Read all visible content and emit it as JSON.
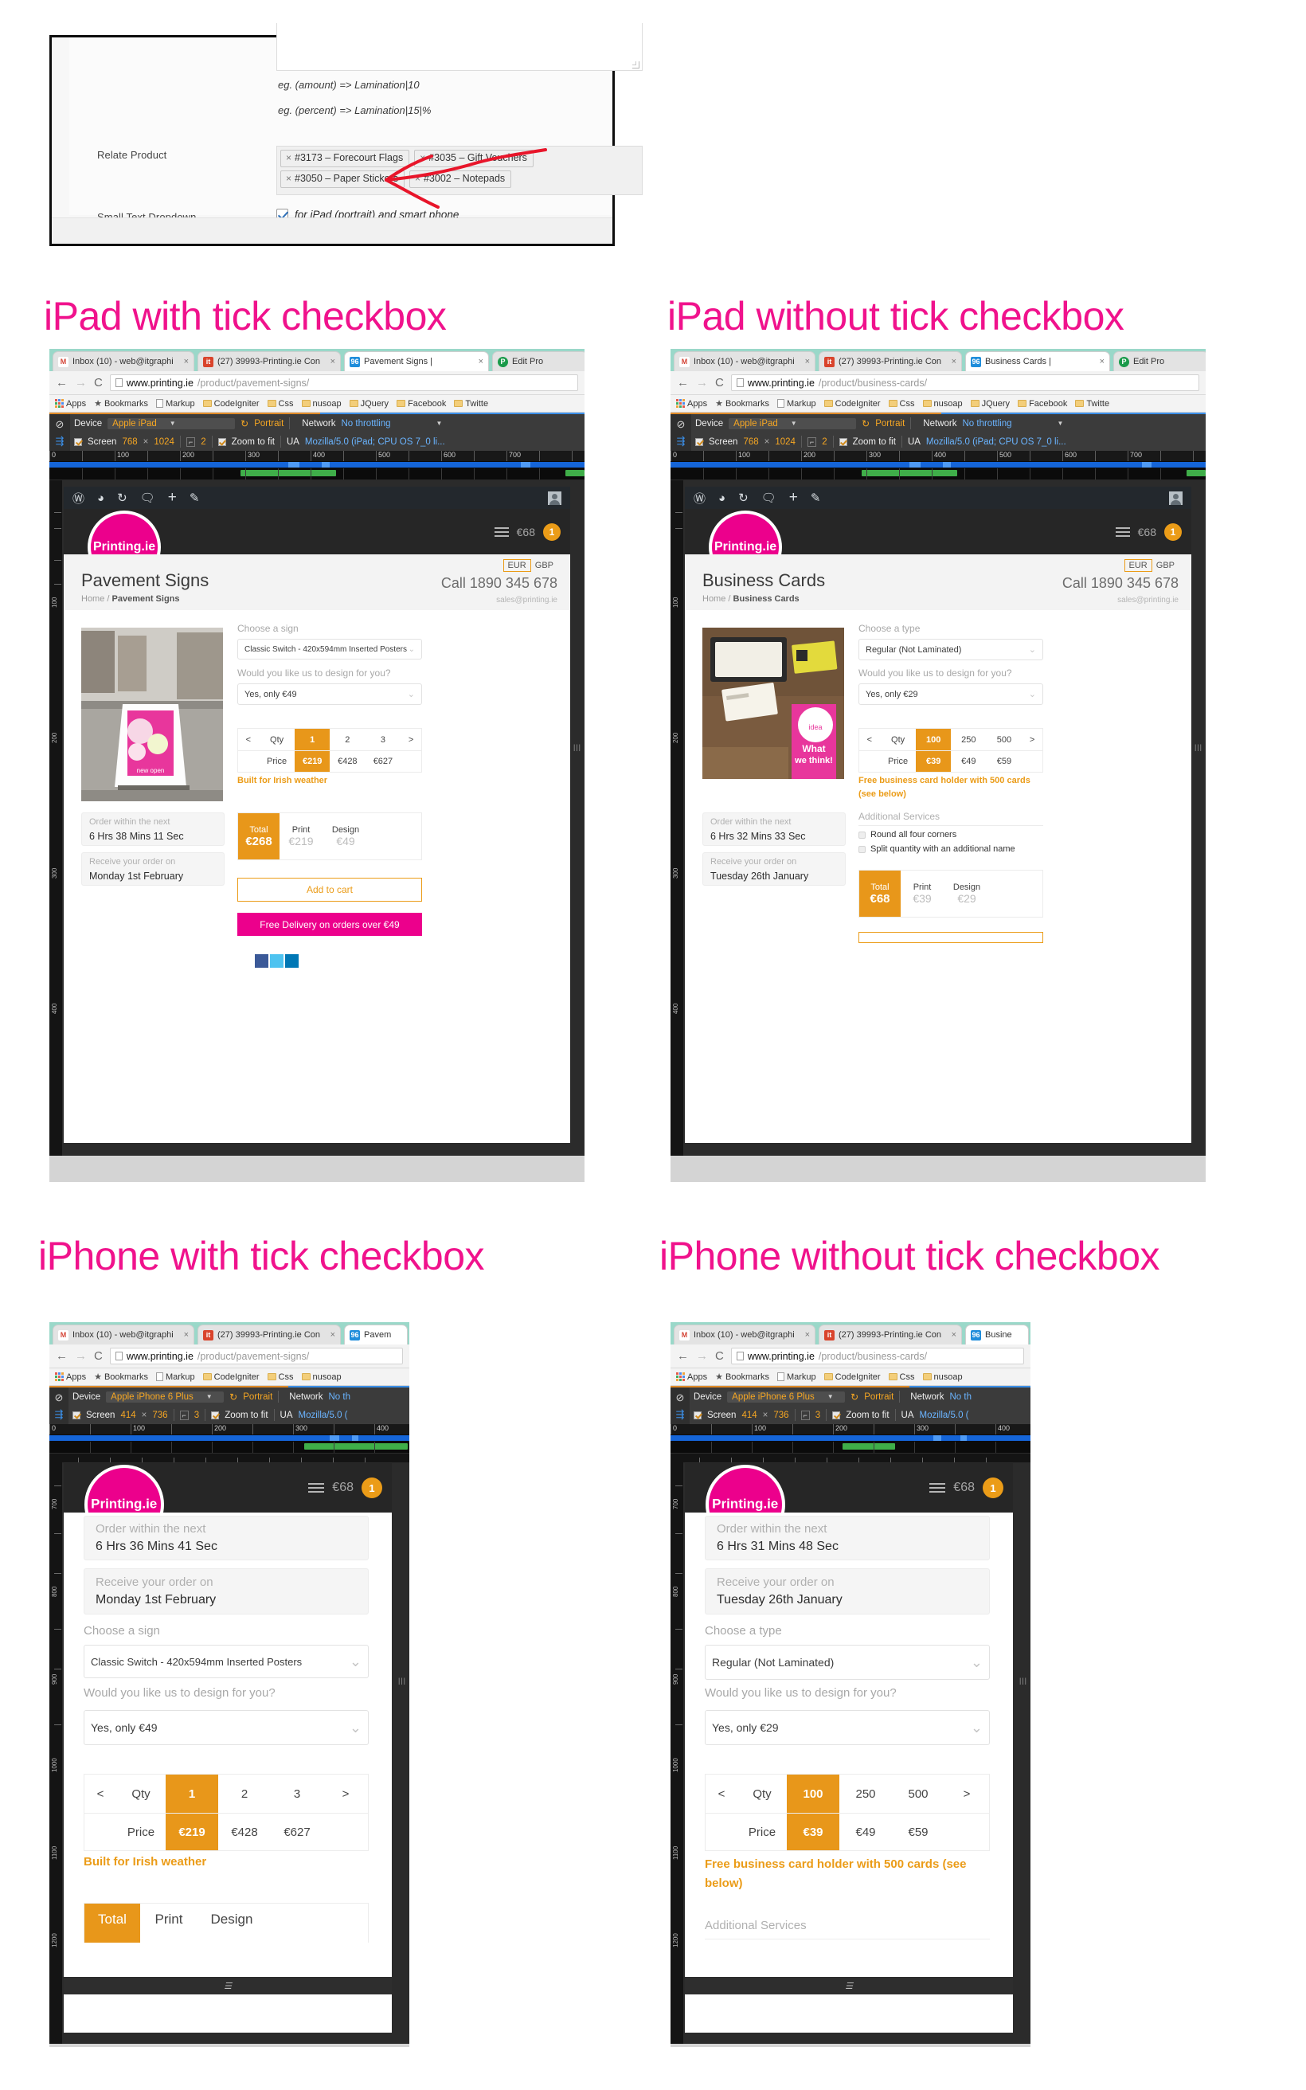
{
  "admin": {
    "hint1": "eg. (amount) => Lamination|10",
    "hint2": "eg. (percent) => Lamination|15|%",
    "relate_label": "Relate Product",
    "tags": [
      "#3173 – Forecourt Flags",
      "#3035 – Gift Vouchers",
      "#3050 – Paper Stickers",
      "#3002 – Notepads"
    ],
    "tag_remove": "×",
    "checkbox_label": "Small Text Dropdown",
    "checkbox_text": "for iPad (portrait) and smart phone",
    "checkbox_checked": true
  },
  "sections": {
    "ipad_with": "iPad with tick checkbox",
    "ipad_without": "iPad without tick checkbox",
    "iphone_with": "iPhone with tick checkbox",
    "iphone_without": "iPhone without tick checkbox"
  },
  "browser": {
    "tabs_pavement": [
      {
        "title": "Inbox (10) - web@itgraphi",
        "fav": "M",
        "favbg": "#ffffff",
        "favcolor": "#d44638",
        "close": "×"
      },
      {
        "title": "(27) 39993-Printing.ie Con",
        "fav": "it",
        "favbg": "#d9442c",
        "favcolor": "#ffffff",
        "close": "×"
      },
      {
        "title": "Pavement Signs |",
        "fav": "96",
        "favbg": "#1f8ddb",
        "favcolor": "#ffffff",
        "close": "×"
      },
      {
        "title": "Edit Pro",
        "fav": "P",
        "favbg": "#1a9a4a",
        "favcolor": "#ffffff",
        "close": ""
      }
    ],
    "tabs_business": [
      {
        "title": "Inbox (10) - web@itgraphi",
        "fav": "M",
        "favbg": "#ffffff",
        "favcolor": "#d44638",
        "close": "×"
      },
      {
        "title": "(27) 39993-Printing.ie Con",
        "fav": "it",
        "favbg": "#d9442c",
        "favcolor": "#ffffff",
        "close": "×"
      },
      {
        "title": "Business Cards |",
        "fav": "96",
        "favbg": "#1f8ddb",
        "favcolor": "#ffffff",
        "close": "×"
      },
      {
        "title": "Edit Pro",
        "fav": "P",
        "favbg": "#1a9a4a",
        "favcolor": "#ffffff",
        "close": ""
      }
    ],
    "tabs_pavement_short": [
      {
        "title": "Inbox (10) - web@itgraphi",
        "fav": "M",
        "favbg": "#ffffff",
        "favcolor": "#d44638",
        "close": "×"
      },
      {
        "title": "(27) 39993-Printing.ie Con",
        "fav": "it",
        "favbg": "#d9442c",
        "favcolor": "#ffffff",
        "close": "×"
      },
      {
        "title": "Pavem",
        "fav": "96",
        "favbg": "#1f8ddb",
        "favcolor": "#ffffff",
        "close": ""
      }
    ],
    "tabs_business_short": [
      {
        "title": "Inbox (10) - web@itgraphi",
        "fav": "M",
        "favbg": "#ffffff",
        "favcolor": "#d44638",
        "close": "×"
      },
      {
        "title": "(27) 39993-Printing.ie Con",
        "fav": "it",
        "favbg": "#d9442c",
        "favcolor": "#ffffff",
        "close": "×"
      },
      {
        "title": "Busine",
        "fav": "96",
        "favbg": "#1f8ddb",
        "favcolor": "#ffffff",
        "close": ""
      }
    ],
    "back": "←",
    "forward": "→",
    "reload": "C",
    "url_pavement_host": "www.printing.ie",
    "url_pavement_path": "/product/pavement-signs/",
    "url_business_host": "www.printing.ie",
    "url_business_path": "/product/business-cards/",
    "bookmarks": [
      "Apps",
      "Bookmarks",
      "Markup",
      "CodeIgniter",
      "Css",
      "nusoap",
      "JQuery",
      "Facebook",
      "Twitte"
    ]
  },
  "devtools": {
    "ipad": {
      "device_label": "Device",
      "device_value": "Apple iPad",
      "orientation": "Portrait",
      "screen_label": "Screen",
      "width": "768",
      "times": "×",
      "height": "1024",
      "dpr": "2",
      "zoom_label": "Zoom to fit",
      "network_label": "Network",
      "network_value": "No throttling",
      "ua_label": "UA",
      "ua_value": "Mozilla/5.0 (iPad; CPU OS 7_0 li...",
      "ticks": [
        "0",
        "100",
        "200",
        "300",
        "400",
        "500",
        "600",
        "700"
      ]
    },
    "iphone": {
      "device_label": "Device",
      "device_value": "Apple iPhone 6 Plus",
      "orientation": "Portrait",
      "screen_label": "Screen",
      "width": "414",
      "times": "×",
      "height": "736",
      "dpr": "3",
      "zoom_label": "Zoom to fit",
      "network_label": "Network",
      "network_value": "No th",
      "ua_label": "UA",
      "ua_value": "Mozilla/5.0 (",
      "ticks": [
        "0",
        "100",
        "200",
        "300",
        "400"
      ]
    }
  },
  "wpbar": {
    "icons": [
      "wordpress-logo",
      "dashboard",
      "updates",
      "comments",
      "new",
      "edit"
    ],
    "glyphs": [
      "Ⓦ",
      "◕",
      "↻",
      "🗨",
      "+",
      "✎"
    ]
  },
  "site": {
    "logo": "Printing.ie",
    "cart_amount": "€68",
    "cart_count": "1",
    "call": "Call 1890 345 678",
    "email": "sales@printing.ie",
    "currency_eur": "EUR",
    "currency_gbp": "GBP"
  },
  "pavement": {
    "title": "Pavement Signs",
    "crumb_home": "Home",
    "crumb_sep": "/",
    "crumb_current": "Pavement Signs",
    "choose_label": "Choose a sign",
    "choose_value": "Classic Switch - 420x594mm Inserted Posters",
    "design_label": "Would you like us to design for you?",
    "design_value": "Yes, only €49",
    "qty_prev": "<",
    "qty_next": ">",
    "qty_header": "Qty",
    "price_header": "Price",
    "qtys": [
      "1",
      "2",
      "3"
    ],
    "prices": [
      "€219",
      "€428",
      "€627"
    ],
    "promo": "Built for Irish weather",
    "order_label": "Order within the next",
    "order_value_ipad": "6 Hrs 38 Mins 11 Sec",
    "order_value_iphone": "6 Hrs 36 Mins 41 Sec",
    "receive_label": "Receive your order on",
    "receive_value": "Monday 1st February",
    "total_label": "Total",
    "total_value": "€268",
    "print_label": "Print",
    "print_value": "€219",
    "design_col_label": "Design",
    "design_col_value": "€49",
    "add_to_cart": "Add to cart",
    "free_delivery": "Free Delivery on orders over €49"
  },
  "business": {
    "title": "Business Cards",
    "crumb_home": "Home",
    "crumb_sep": "/",
    "crumb_current": "Business Cards",
    "choose_label": "Choose a type",
    "choose_value": "Regular (Not Laminated)",
    "design_label": "Would you like us to design for you?",
    "design_value": "Yes, only €29",
    "qty_prev": "<",
    "qty_next": ">",
    "qty_header": "Qty",
    "price_header": "Price",
    "qtys": [
      "100",
      "250",
      "500"
    ],
    "prices": [
      "€39",
      "€49",
      "€59"
    ],
    "promo": "Free business card holder with 500 cards (see below)",
    "promo_iphone": "Free business card holder with 500 cards (see below)",
    "order_label": "Order within the next",
    "order_value_ipad": "6 Hrs 32 Mins 33 Sec",
    "order_value_iphone": "6 Hrs 31 Mins 48 Sec",
    "receive_label": "Receive your order on",
    "receive_value": "Tuesday 26th January",
    "additional_services": "Additional Services",
    "service_1": "Round all four corners",
    "service_2": "Split quantity with an additional name",
    "total_label": "Total",
    "total_value": "€68",
    "print_label": "Print",
    "print_value": "€39",
    "design_col_label": "Design",
    "design_col_value": "€29",
    "card_image_text": "What we think!",
    "card_image_sub": "idea"
  }
}
